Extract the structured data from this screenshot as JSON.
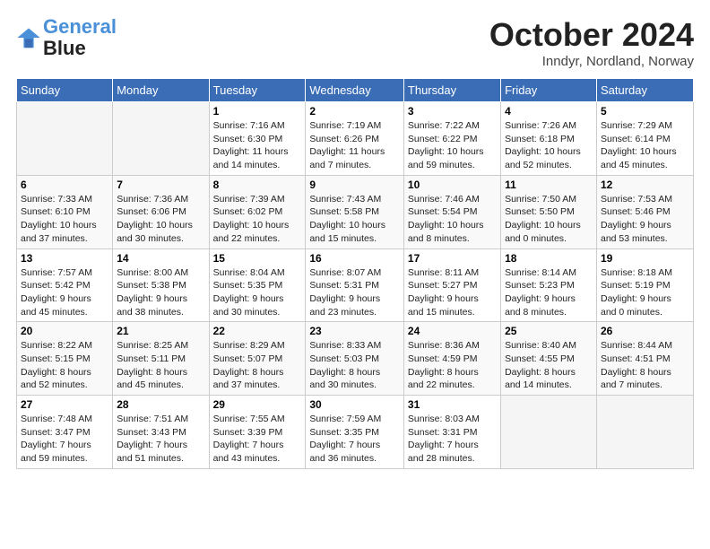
{
  "header": {
    "logo_line1": "General",
    "logo_line2": "Blue",
    "month": "October 2024",
    "location": "Inndyr, Nordland, Norway"
  },
  "weekdays": [
    "Sunday",
    "Monday",
    "Tuesday",
    "Wednesday",
    "Thursday",
    "Friday",
    "Saturday"
  ],
  "weeks": [
    [
      {
        "day": "",
        "info": ""
      },
      {
        "day": "",
        "info": ""
      },
      {
        "day": "1",
        "info": "Sunrise: 7:16 AM\nSunset: 6:30 PM\nDaylight: 11 hours\nand 14 minutes."
      },
      {
        "day": "2",
        "info": "Sunrise: 7:19 AM\nSunset: 6:26 PM\nDaylight: 11 hours\nand 7 minutes."
      },
      {
        "day": "3",
        "info": "Sunrise: 7:22 AM\nSunset: 6:22 PM\nDaylight: 10 hours\nand 59 minutes."
      },
      {
        "day": "4",
        "info": "Sunrise: 7:26 AM\nSunset: 6:18 PM\nDaylight: 10 hours\nand 52 minutes."
      },
      {
        "day": "5",
        "info": "Sunrise: 7:29 AM\nSunset: 6:14 PM\nDaylight: 10 hours\nand 45 minutes."
      }
    ],
    [
      {
        "day": "6",
        "info": "Sunrise: 7:33 AM\nSunset: 6:10 PM\nDaylight: 10 hours\nand 37 minutes."
      },
      {
        "day": "7",
        "info": "Sunrise: 7:36 AM\nSunset: 6:06 PM\nDaylight: 10 hours\nand 30 minutes."
      },
      {
        "day": "8",
        "info": "Sunrise: 7:39 AM\nSunset: 6:02 PM\nDaylight: 10 hours\nand 22 minutes."
      },
      {
        "day": "9",
        "info": "Sunrise: 7:43 AM\nSunset: 5:58 PM\nDaylight: 10 hours\nand 15 minutes."
      },
      {
        "day": "10",
        "info": "Sunrise: 7:46 AM\nSunset: 5:54 PM\nDaylight: 10 hours\nand 8 minutes."
      },
      {
        "day": "11",
        "info": "Sunrise: 7:50 AM\nSunset: 5:50 PM\nDaylight: 10 hours\nand 0 minutes."
      },
      {
        "day": "12",
        "info": "Sunrise: 7:53 AM\nSunset: 5:46 PM\nDaylight: 9 hours\nand 53 minutes."
      }
    ],
    [
      {
        "day": "13",
        "info": "Sunrise: 7:57 AM\nSunset: 5:42 PM\nDaylight: 9 hours\nand 45 minutes."
      },
      {
        "day": "14",
        "info": "Sunrise: 8:00 AM\nSunset: 5:38 PM\nDaylight: 9 hours\nand 38 minutes."
      },
      {
        "day": "15",
        "info": "Sunrise: 8:04 AM\nSunset: 5:35 PM\nDaylight: 9 hours\nand 30 minutes."
      },
      {
        "day": "16",
        "info": "Sunrise: 8:07 AM\nSunset: 5:31 PM\nDaylight: 9 hours\nand 23 minutes."
      },
      {
        "day": "17",
        "info": "Sunrise: 8:11 AM\nSunset: 5:27 PM\nDaylight: 9 hours\nand 15 minutes."
      },
      {
        "day": "18",
        "info": "Sunrise: 8:14 AM\nSunset: 5:23 PM\nDaylight: 9 hours\nand 8 minutes."
      },
      {
        "day": "19",
        "info": "Sunrise: 8:18 AM\nSunset: 5:19 PM\nDaylight: 9 hours\nand 0 minutes."
      }
    ],
    [
      {
        "day": "20",
        "info": "Sunrise: 8:22 AM\nSunset: 5:15 PM\nDaylight: 8 hours\nand 52 minutes."
      },
      {
        "day": "21",
        "info": "Sunrise: 8:25 AM\nSunset: 5:11 PM\nDaylight: 8 hours\nand 45 minutes."
      },
      {
        "day": "22",
        "info": "Sunrise: 8:29 AM\nSunset: 5:07 PM\nDaylight: 8 hours\nand 37 minutes."
      },
      {
        "day": "23",
        "info": "Sunrise: 8:33 AM\nSunset: 5:03 PM\nDaylight: 8 hours\nand 30 minutes."
      },
      {
        "day": "24",
        "info": "Sunrise: 8:36 AM\nSunset: 4:59 PM\nDaylight: 8 hours\nand 22 minutes."
      },
      {
        "day": "25",
        "info": "Sunrise: 8:40 AM\nSunset: 4:55 PM\nDaylight: 8 hours\nand 14 minutes."
      },
      {
        "day": "26",
        "info": "Sunrise: 8:44 AM\nSunset: 4:51 PM\nDaylight: 8 hours\nand 7 minutes."
      }
    ],
    [
      {
        "day": "27",
        "info": "Sunrise: 7:48 AM\nSunset: 3:47 PM\nDaylight: 7 hours\nand 59 minutes."
      },
      {
        "day": "28",
        "info": "Sunrise: 7:51 AM\nSunset: 3:43 PM\nDaylight: 7 hours\nand 51 minutes."
      },
      {
        "day": "29",
        "info": "Sunrise: 7:55 AM\nSunset: 3:39 PM\nDaylight: 7 hours\nand 43 minutes."
      },
      {
        "day": "30",
        "info": "Sunrise: 7:59 AM\nSunset: 3:35 PM\nDaylight: 7 hours\nand 36 minutes."
      },
      {
        "day": "31",
        "info": "Sunrise: 8:03 AM\nSunset: 3:31 PM\nDaylight: 7 hours\nand 28 minutes."
      },
      {
        "day": "",
        "info": ""
      },
      {
        "day": "",
        "info": ""
      }
    ]
  ]
}
